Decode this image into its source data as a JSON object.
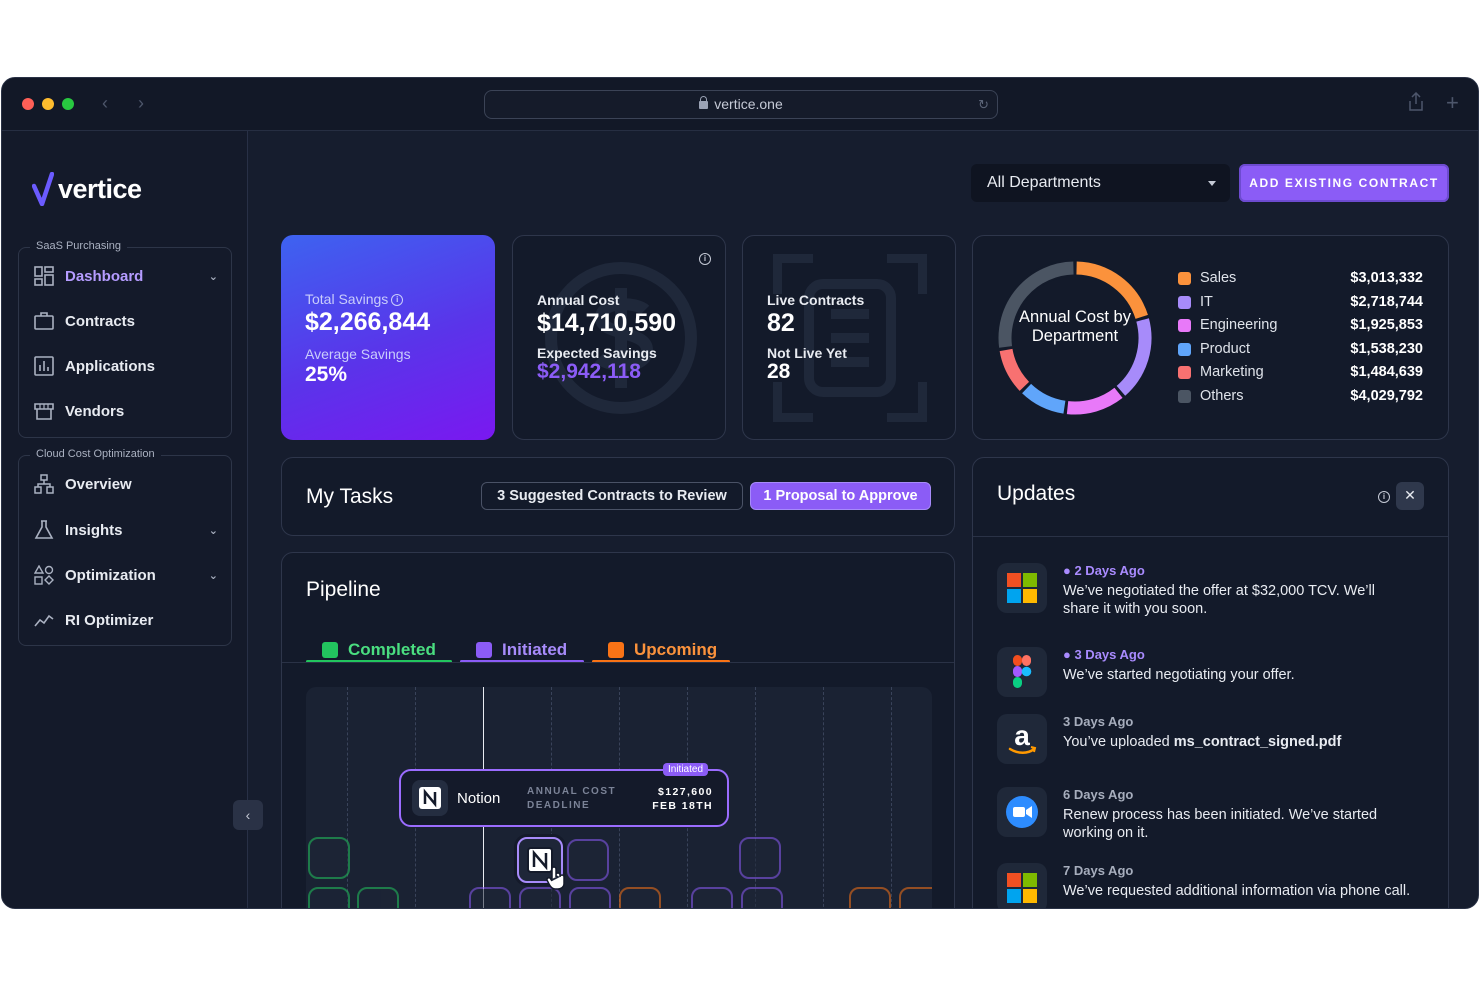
{
  "browser": {
    "url": "vertice.one"
  },
  "brand": {
    "name": "vertice",
    "accent": "#8b5cf6"
  },
  "sidebar": {
    "groups": [
      {
        "label": "SaaS Purchasing",
        "items": [
          {
            "label": "Dashboard",
            "icon": "dashboard-icon",
            "active": true,
            "expandable": true
          },
          {
            "label": "Contracts",
            "icon": "briefcase-icon"
          },
          {
            "label": "Applications",
            "icon": "applications-icon"
          },
          {
            "label": "Vendors",
            "icon": "store-icon"
          }
        ]
      },
      {
        "label": "Cloud Cost Optimization",
        "items": [
          {
            "label": "Overview",
            "icon": "hierarchy-icon"
          },
          {
            "label": "Insights",
            "icon": "flask-icon",
            "expandable": true
          },
          {
            "label": "Optimization",
            "icon": "shapes-icon",
            "expandable": true
          },
          {
            "label": "RI Optimizer",
            "icon": "trend-icon"
          }
        ]
      }
    ]
  },
  "header": {
    "department_select": "All Departments",
    "add_button": "ADD EXISTING CONTRACT"
  },
  "stats": {
    "savings": {
      "label": "Total Savings",
      "value": "$2,266,844",
      "sub_label": "Average Savings",
      "sub_value": "25%"
    },
    "cost": {
      "label": "Annual Cost",
      "value": "$14,710,590",
      "sub_label": "Expected Savings",
      "sub_value": "$2,942,118"
    },
    "contracts": {
      "label": "Live Contracts",
      "value": "82",
      "sub_label": "Not Live Yet",
      "sub_value": "28"
    }
  },
  "chart_data": {
    "type": "pie",
    "title": "Annual Cost by Department",
    "categories": [
      "Sales",
      "IT",
      "Engineering",
      "Product",
      "Marketing",
      "Others"
    ],
    "values": [
      3013332,
      2718744,
      1925853,
      1538230,
      1484639,
      4029792
    ],
    "labels": [
      "$3,013,332",
      "$2,718,744",
      "$1,925,853",
      "$1,538,230",
      "$1,484,639",
      "$4,029,792"
    ],
    "colors": [
      "#fb923c",
      "#a78bfa",
      "#e879f9",
      "#60a5fa",
      "#f87171",
      "#4b5563"
    ],
    "legend": "right"
  },
  "tasks": {
    "title": "My Tasks",
    "review": "3 Suggested Contracts to Review",
    "approve": "1 Proposal to Approve"
  },
  "pipeline": {
    "title": "Pipeline",
    "tabs": [
      {
        "label": "Completed",
        "color": "#22c55e"
      },
      {
        "label": "Initiated",
        "color": "#8b5cf6"
      },
      {
        "label": "Upcoming",
        "color": "#f97316"
      }
    ],
    "popover": {
      "badge": "Initiated",
      "app": "Notion",
      "cost_label": "ANNUAL COST",
      "deadline_label": "DEADLINE",
      "cost_value": "$127,600",
      "deadline_value": "FEB 18TH"
    }
  },
  "updates": {
    "title": "Updates",
    "items": [
      {
        "when": "2 Days Ago",
        "new": true,
        "icon": "microsoft-icon",
        "text": "We’ve negotiated the offer at $32,000 TCV. We’ll share it with you soon."
      },
      {
        "when": "3 Days Ago",
        "new": true,
        "icon": "figma-icon",
        "text": "We’ve started negotiating your offer."
      },
      {
        "when": "3 Days Ago",
        "new": false,
        "icon": "amazon-icon",
        "text": "You’ve uploaded ",
        "bold": "ms_contract_signed.pdf"
      },
      {
        "when": "6 Days Ago",
        "new": false,
        "icon": "zoom-icon",
        "text": "Renew process has been initiated. We’ve started working on it."
      },
      {
        "when": "7 Days Ago",
        "new": false,
        "icon": "microsoft-icon",
        "text": "We’ve requested additional information via phone call."
      }
    ]
  }
}
